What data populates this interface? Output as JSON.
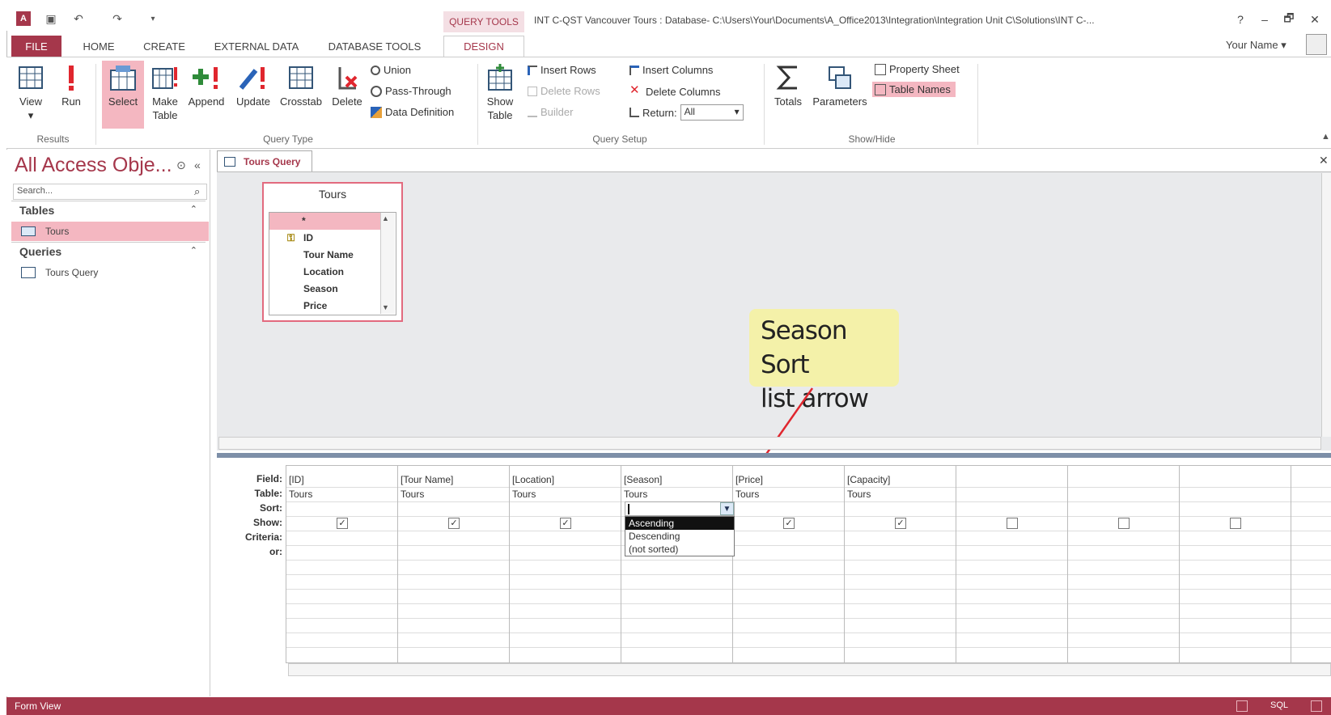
{
  "window": {
    "context_tab": "QUERY TOOLS",
    "title": "INT C-QST Vancouver Tours : Database- C:\\Users\\Your\\Documents\\A_Office2013\\Integration\\Integration Unit C\\Solutions\\INT C-...",
    "help": "?",
    "minimize": "–",
    "restore": "🗗",
    "close": "✕",
    "user": "Your Name",
    "user_caret": "▾"
  },
  "tabs": [
    "FILE",
    "HOME",
    "CREATE",
    "EXTERNAL DATA",
    "DATABASE TOOLS",
    "DESIGN"
  ],
  "ribbon": {
    "results": {
      "view": "View",
      "run": "Run",
      "group": "Results"
    },
    "query_type": {
      "select": "Select",
      "make_table_1": "Make",
      "make_table_2": "Table",
      "append": "Append",
      "update": "Update",
      "crosstab": "Crosstab",
      "delete": "Delete",
      "union": "Union",
      "pass_through": "Pass-Through",
      "data_definition": "Data Definition",
      "group": "Query Type"
    },
    "query_setup": {
      "show_table_1": "Show",
      "show_table_2": "Table",
      "insert_rows": "Insert Rows",
      "delete_rows": "Delete Rows",
      "builder": "Builder",
      "insert_columns": "Insert Columns",
      "delete_columns": "Delete Columns",
      "return_label": "Return:",
      "return_value": "All",
      "group": "Query Setup"
    },
    "show_hide": {
      "totals": "Totals",
      "parameters": "Parameters",
      "property_sheet": "Property Sheet",
      "table_names": "Table Names",
      "group": "Show/Hide"
    }
  },
  "nav": {
    "title": "All Access Obje...",
    "search_placeholder": "Search...",
    "tables_header": "Tables",
    "tables": [
      "Tours"
    ],
    "queries_header": "Queries",
    "queries": [
      "Tours Query"
    ]
  },
  "document": {
    "tab": "Tours Query",
    "table_title": "Tours",
    "fields": [
      "*",
      "ID",
      "Tour Name",
      "Location",
      "Season",
      "Price"
    ]
  },
  "callout": {
    "line1": "Season Sort",
    "line2": "list arrow"
  },
  "grid": {
    "row_labels": [
      "Field:",
      "Table:",
      "Sort:",
      "Show:",
      "Criteria:",
      "or:"
    ],
    "columns": [
      {
        "field": "[ID]",
        "table": "Tours",
        "show": true
      },
      {
        "field": "[Tour Name]",
        "table": "Tours",
        "show": true
      },
      {
        "field": "[Location]",
        "table": "Tours",
        "show": true
      },
      {
        "field": "[Season]",
        "table": "Tours",
        "show": true
      },
      {
        "field": "[Price]",
        "table": "Tours",
        "show": true
      },
      {
        "field": "[Capacity]",
        "table": "Tours",
        "show": true
      },
      {
        "field": "",
        "table": "",
        "show": false
      },
      {
        "field": "",
        "table": "",
        "show": false
      },
      {
        "field": "",
        "table": "",
        "show": false
      }
    ],
    "sort_options": [
      "Ascending",
      "Descending",
      "(not sorted)"
    ],
    "sort_highlight": "Ascending"
  },
  "status": {
    "text": "Form View"
  },
  "colors": {
    "accent": "#a5374b",
    "highlight": "#f4b7c1",
    "callout": "#f4f1a9",
    "arrow": "#e0262e"
  }
}
